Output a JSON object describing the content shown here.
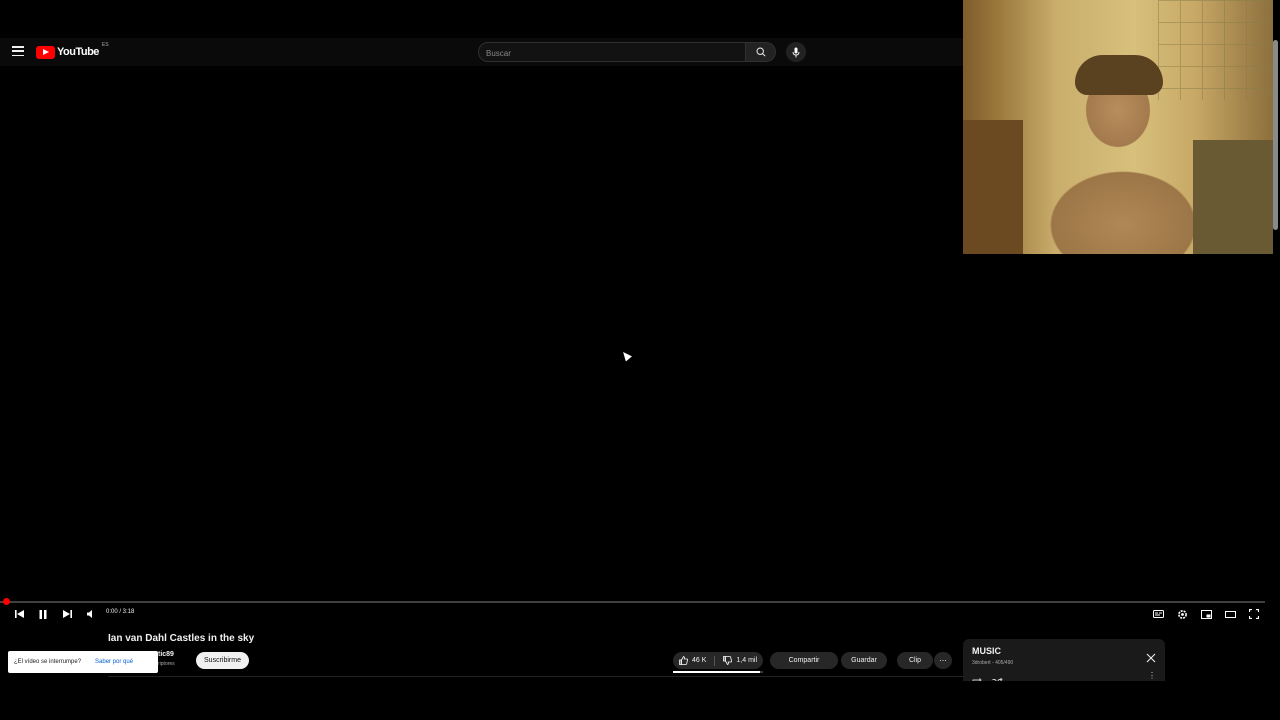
{
  "masthead": {
    "logo_text": "YouTube",
    "logo_region": "ES",
    "search_placeholder": "Buscar",
    "icons": [
      "menu-icon",
      "search-icon",
      "mic-icon"
    ]
  },
  "player": {
    "time": "0:00 / 3:18",
    "progress_fraction": 0.0,
    "icons": [
      "previous-icon",
      "pause-icon",
      "next-icon",
      "volume-icon",
      "subtitles-icon",
      "settings-icon",
      "miniplayer-icon",
      "theater-icon",
      "fullscreen-icon"
    ]
  },
  "video": {
    "title": "Ian van Dahl Castles in the sky",
    "channel_name": "tic89",
    "channel_subs": "riptores",
    "subscribe_label": "Suscribirme",
    "likes": "46 K",
    "dislikes": "1,4 mil",
    "like_ratio": 0.97,
    "share_label": "Compartir",
    "save_label": "Guardar",
    "clip_label": "Clip",
    "more_label": "⋯"
  },
  "popup": {
    "question": "¿El vídeo se interrumpe?",
    "link": "Saber por qué"
  },
  "playlist": {
    "title": "MUSIC",
    "subtitle": "3drobert - 405/490",
    "more_label": "⋮"
  },
  "colors": {
    "accent": "#ff0000",
    "background": "#000000",
    "pill": "#272727",
    "link": "#065fd4"
  }
}
